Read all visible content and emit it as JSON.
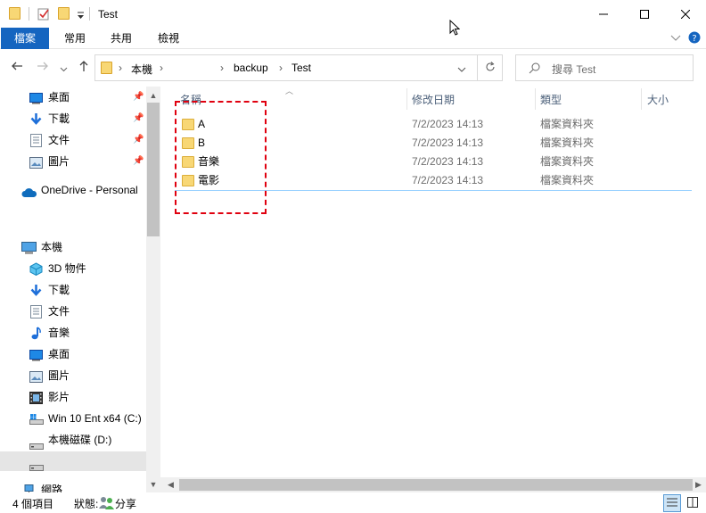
{
  "window": {
    "title": "Test",
    "controls": {
      "minimize": "minimize-icon",
      "maximize": "maximize-icon",
      "close": "close-icon"
    }
  },
  "ribbon": {
    "tabs": [
      "檔案",
      "常用",
      "共用",
      "檢視"
    ]
  },
  "address": {
    "crumbs": [
      "本機",
      "backup",
      "Test"
    ]
  },
  "search": {
    "placeholder": "搜尋 Test"
  },
  "nav": {
    "quick_access": [
      {
        "label": "桌面",
        "icon": "desktop-icon"
      },
      {
        "label": "下載",
        "icon": "download-icon"
      },
      {
        "label": "文件",
        "icon": "document-icon"
      },
      {
        "label": "圖片",
        "icon": "picture-icon"
      }
    ],
    "onedrive": "OneDrive - Personal",
    "this_pc": "本機",
    "pc_items": [
      {
        "label": "3D 物件",
        "icon": "3d-objects-icon"
      },
      {
        "label": "下載",
        "icon": "download-icon"
      },
      {
        "label": "文件",
        "icon": "document-icon"
      },
      {
        "label": "音樂",
        "icon": "music-icon"
      },
      {
        "label": "桌面",
        "icon": "desktop-icon"
      },
      {
        "label": "圖片",
        "icon": "picture-icon"
      },
      {
        "label": "影片",
        "icon": "video-icon"
      },
      {
        "label": "Win 10 Ent x64 (C:)",
        "icon": "windows-drive-icon"
      },
      {
        "label": "本機磁碟 (D:)",
        "icon": "drive-icon"
      },
      {
        "label": "",
        "icon": "drive-icon"
      }
    ],
    "network": "網路"
  },
  "columns": {
    "name": "名稱",
    "date": "修改日期",
    "type": "類型",
    "size": "大小"
  },
  "files": [
    {
      "name": "A",
      "date": "7/2/2023 14:13",
      "type": "檔案資料夾"
    },
    {
      "name": "B",
      "date": "7/2/2023 14:13",
      "type": "檔案資料夾"
    },
    {
      "name": "音樂",
      "date": "7/2/2023 14:13",
      "type": "檔案資料夾"
    },
    {
      "name": "電影",
      "date": "7/2/2023 14:13",
      "type": "檔案資料夾"
    }
  ],
  "status": {
    "count": "4 個項目",
    "state_label": "狀態:",
    "share": "分享"
  },
  "colors": {
    "accent": "#1565c0",
    "highlight": "#e0000f"
  }
}
